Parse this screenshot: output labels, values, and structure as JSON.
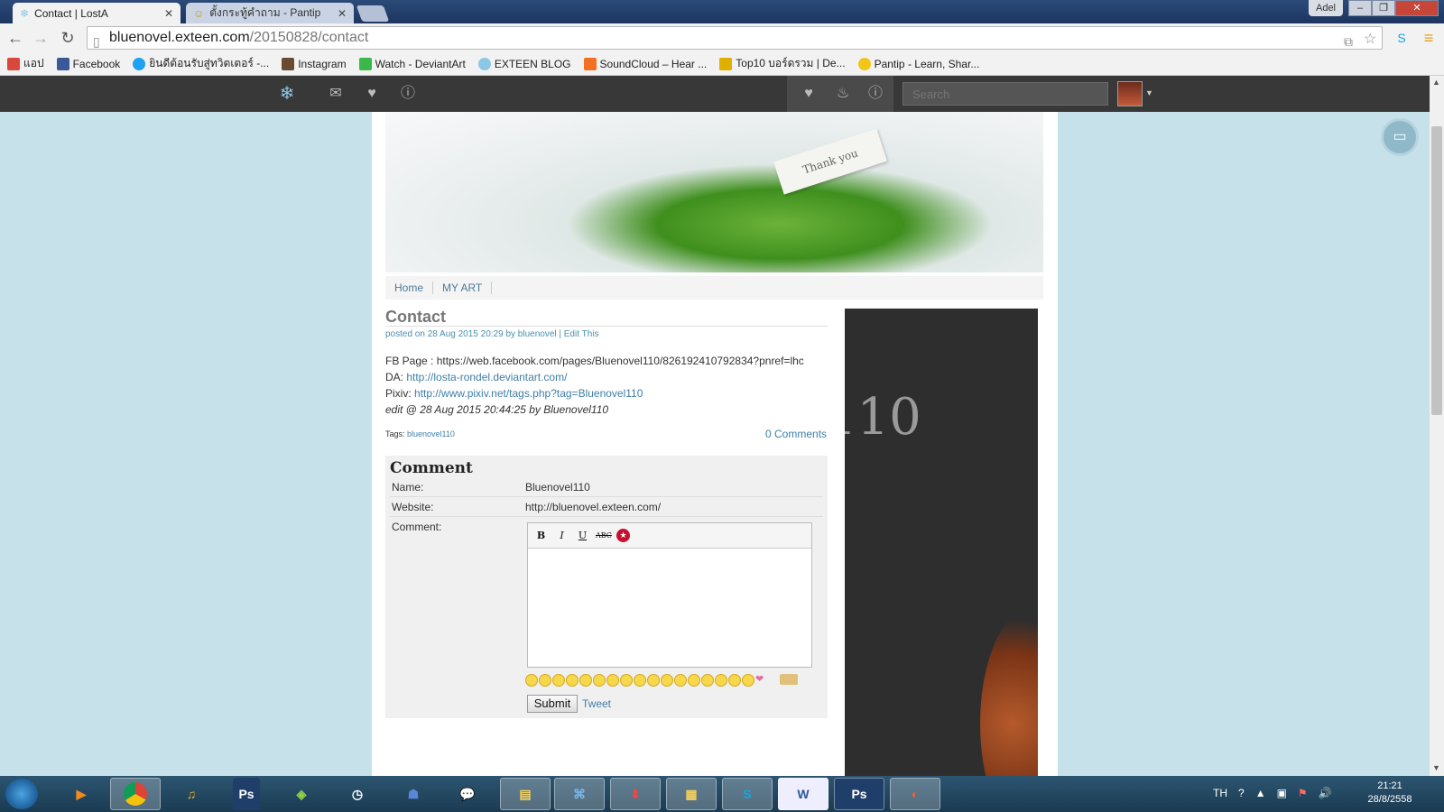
{
  "browser": {
    "tabs": [
      {
        "label": "Contact | LostA",
        "active": true
      },
      {
        "label": "ตั้งกระทู้คำถาม - Pantip",
        "active": false
      }
    ],
    "window_user": "Adel",
    "url_host": "bluenovel.exteen.com",
    "url_path": "/20150828/contact",
    "bookmarks": [
      {
        "label": "แอป",
        "icon": "apps-icon",
        "color": "#d9483b"
      },
      {
        "label": "Facebook",
        "icon": "facebook-icon",
        "color": "#3b5998"
      },
      {
        "label": "ยินดีต้อนรับสู่ทวิตเตอร์ -...",
        "icon": "twitter-icon",
        "color": "#1da1f2"
      },
      {
        "label": "Instagram",
        "icon": "instagram-icon",
        "color": "#6b4a32"
      },
      {
        "label": "Watch - DeviantArt",
        "icon": "deviantart-icon",
        "color": "#3bb84a"
      },
      {
        "label": "EXTEEN BLOG",
        "icon": "exteen-icon",
        "color": "#8ac8e6"
      },
      {
        "label": "SoundCloud – Hear ...",
        "icon": "soundcloud-icon",
        "color": "#f26f23"
      },
      {
        "label": "Top10 บอร์ดรวม | De...",
        "icon": "top10-icon",
        "color": "#e0b000"
      },
      {
        "label": "Pantip - Learn, Shar...",
        "icon": "pantip-icon",
        "color": "#f3c518"
      }
    ]
  },
  "exteen_bar": {
    "search_placeholder": "Search"
  },
  "blog": {
    "banner_text": "Thank you",
    "nav": [
      "Home",
      "MY ART"
    ],
    "post": {
      "title": "Contact",
      "meta": "posted on 28 Aug 2015 20:29 by bluenovel | Edit This",
      "fb_label": "FB Page : ",
      "fb_value": "https://web.facebook.com/pages/Bluenovel110/826192410792834?pnref=lhc",
      "da_label": "DA: ",
      "da_value": "http://losta-rondel.deviantart.com/",
      "pixiv_label": "Pixiv: ",
      "pixiv_value": "http://www.pixiv.net/tags.php?tag=Bluenovel110",
      "edit_note": "edit @ 28 Aug 2015 20:44:25 by Bluenovel110",
      "tags_label": "Tags: ",
      "tags_value": "bluenovel110",
      "comments_link": "0 Comments"
    },
    "comment_form": {
      "title": "Comment",
      "name_label": "Name:",
      "name_value": "Bluenovel110",
      "website_label": "Website:",
      "website_value": "http://bluenovel.exteen.com/",
      "comment_label": "Comment:",
      "submit_label": "Submit",
      "tweet_label": "Tweet"
    },
    "sidebar_text": "l110"
  },
  "taskbar": {
    "language": "TH",
    "time": "21:21",
    "date": "28/8/2558"
  }
}
